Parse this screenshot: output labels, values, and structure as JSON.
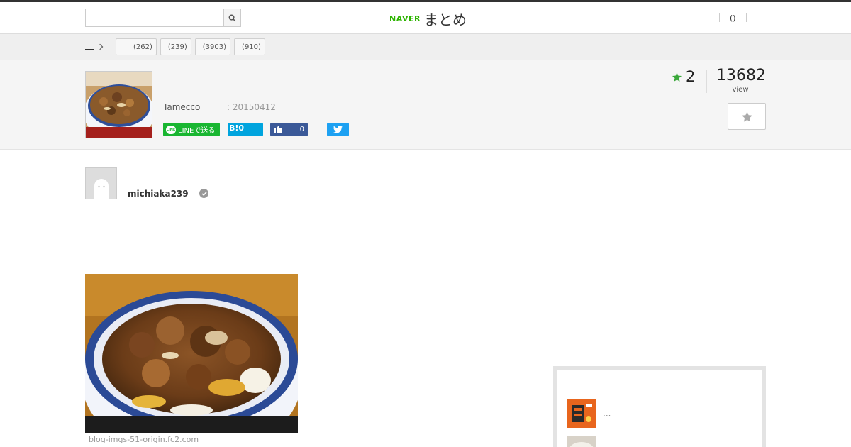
{
  "header": {
    "search": {
      "value": "",
      "placeholder": ""
    },
    "logo": {
      "naver": "NAVER",
      "matome": "まとめ"
    },
    "right_link": "()"
  },
  "breadcrumb": {
    "home": "",
    "tags": [
      {
        "label": "(262)"
      },
      {
        "label": "(239)"
      },
      {
        "label": "(3903)"
      },
      {
        "label": "(910)"
      }
    ]
  },
  "article": {
    "author": "Tamecco",
    "date": ": 20150412",
    "share": {
      "line": "LINEで送る",
      "hatena": "B!",
      "hatena_count": "0",
      "facebook_count": "0"
    },
    "favorites": "2",
    "views": "13682",
    "views_label": "view"
  },
  "content": {
    "curator": "michiaka239",
    "image_source": "blog-imgs-51-origin.fc2.com"
  },
  "sidebar": {
    "items": [
      {
        "text": "..."
      },
      {
        "text": ""
      }
    ]
  },
  "colors": {
    "naver_green": "#2db400",
    "line_green": "#19b631",
    "hatena_blue": "#00a4de",
    "facebook_blue": "#3b5998",
    "twitter_blue": "#1da1f2",
    "fav_star": "#3aa83a"
  },
  "icons": [
    "search-icon",
    "star-icon",
    "thumbs-up-icon",
    "twitter-bird-icon",
    "verified-icon",
    "chevron-right-icon"
  ]
}
